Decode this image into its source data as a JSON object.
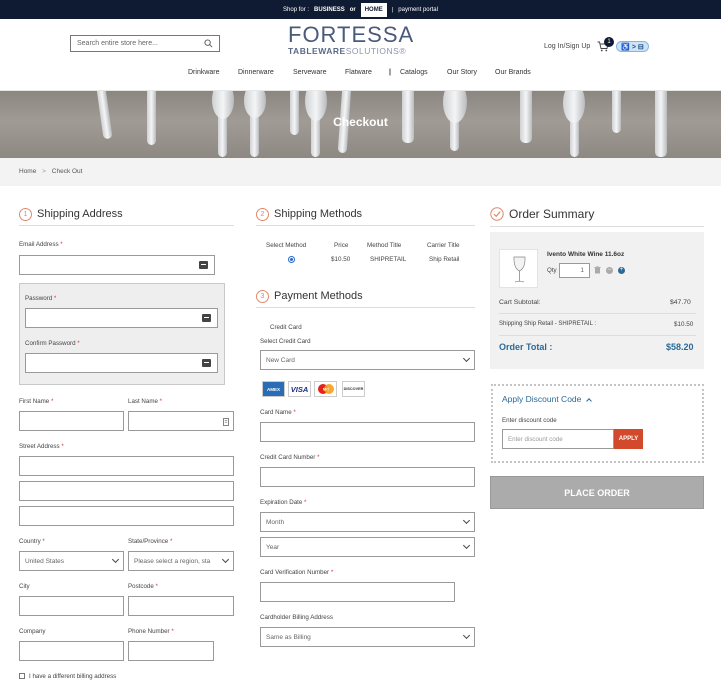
{
  "topbar": {
    "shop_for": "Shop for :",
    "business": "BUSINESS",
    "or": "or",
    "home": "HOME",
    "sep": "|",
    "payment_portal": "payment portal"
  },
  "header": {
    "search_placeholder": "Search entire store here...",
    "logo_line1": "FORTESSA",
    "logo_line2_bold": "TABLEWARE",
    "logo_line2_light": "SOLUTIONS",
    "logo_mark": "®",
    "login": "Log In/Sign Up",
    "cart_count": "1",
    "a11y_label": "♿ > ⊟"
  },
  "nav": {
    "items": [
      "Drinkware",
      "Dinnerware",
      "Serveware",
      "Flatware",
      "|",
      "Catalogs",
      "Our Story",
      "Our Brands"
    ]
  },
  "hero": {
    "title": "Checkout"
  },
  "breadcrumb": {
    "home": "Home",
    "arrow": ">",
    "current": "Check Out"
  },
  "shipping_address": {
    "step": "1",
    "title": "Shipping Address",
    "email_label": "Email Address",
    "password_label": "Password",
    "confirm_password_label": "Confirm Password",
    "first_name_label": "First Name",
    "last_name_label": "Last Name",
    "street_label": "Street Address",
    "country_label": "Country",
    "country_value": "United States",
    "state_label": "State/Province",
    "state_value": "Please select a region, sta",
    "city_label": "City",
    "postcode_label": "Postcode",
    "company_label": "Company",
    "phone_label": "Phone Number",
    "billing_checkbox": "I have a different billing address",
    "required_mark": "*"
  },
  "shipping_methods": {
    "step": "2",
    "title": "Shipping Methods",
    "headers": [
      "Select Method",
      "Price",
      "Method Title",
      "Carrier Title"
    ],
    "row": {
      "price": "$10.50",
      "method_title": "SHIPRETAIL",
      "carrier_title": "Ship Retail"
    }
  },
  "payment_methods": {
    "step": "3",
    "title": "Payment Methods",
    "credit_card_label": "Credit Card",
    "select_card_label": "Select Credit Card",
    "select_card_value": "New Card",
    "card_logos": [
      "AMEX",
      "VISA",
      "MC",
      "DISCOVER"
    ],
    "card_name_label": "Card Name",
    "card_number_label": "Credit Card Number",
    "expiration_label": "Expiration Date",
    "month_value": "Month",
    "year_value": "Year",
    "cvv_label": "Card Verification Number",
    "billing_address_label": "Cardholder Billing Address",
    "billing_address_value": "Same as Billing"
  },
  "order_summary": {
    "title": "Order Summary",
    "product_name": "Ivento White Wine 11.6oz",
    "qty_label": "Qty",
    "qty_value": "1",
    "subtotal_label": "Cart Subtotal:",
    "subtotal_value": "$47.70",
    "shipping_label": "Shipping Ship Retail - SHIPRETAIL :",
    "shipping_value": "$10.50",
    "total_label": "Order Total :",
    "total_value": "$58.20"
  },
  "discount": {
    "title": "Apply Discount Code",
    "enter_label": "Enter discount code",
    "placeholder": "Enter discount code",
    "apply_label": "APPLY"
  },
  "place_order": {
    "label": "PLACE ORDER"
  }
}
